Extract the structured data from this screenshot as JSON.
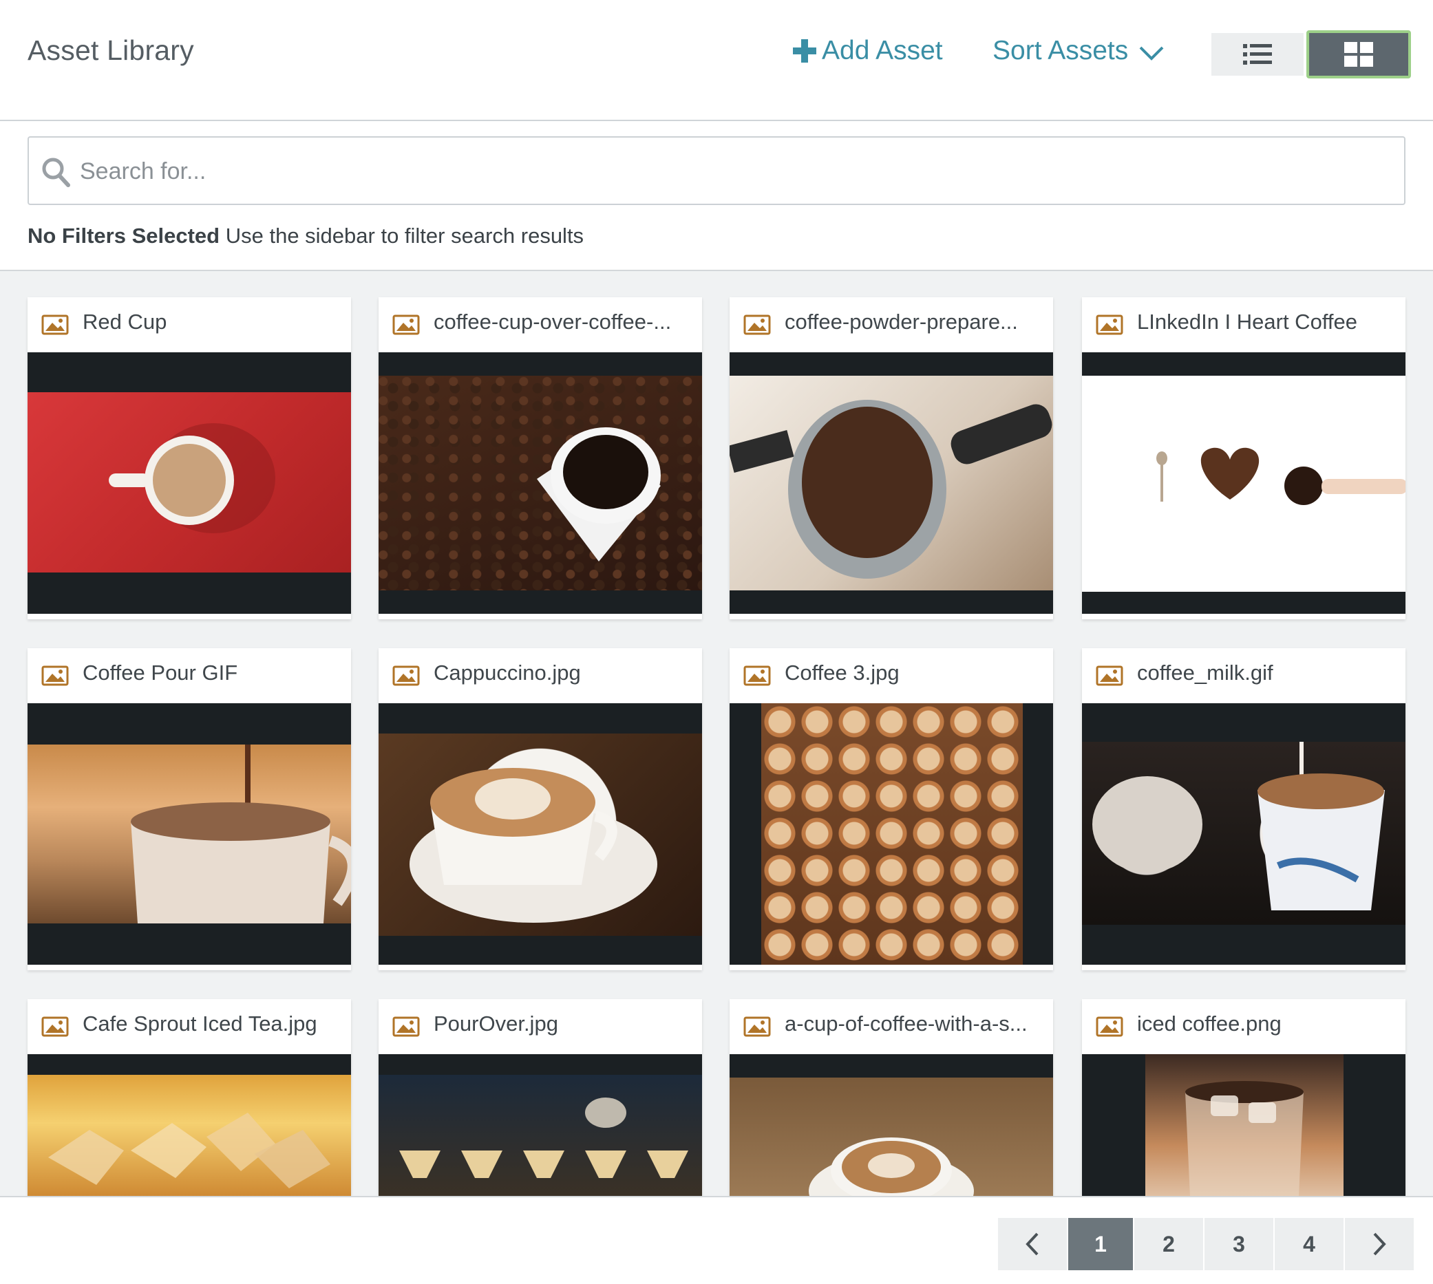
{
  "header": {
    "title": "Asset Library",
    "add_asset_label": "Add Asset",
    "sort_assets_label": "Sort Assets",
    "view_mode": "grid"
  },
  "search": {
    "placeholder": "Search for...",
    "value": ""
  },
  "filters": {
    "status_bold": "No Filters Selected",
    "status_hint": "Use the sidebar to filter search results"
  },
  "assets": [
    {
      "title": "Red Cup",
      "icon": "image-icon",
      "thumb": "red-cup"
    },
    {
      "title": "coffee-cup-over-coffee-...",
      "icon": "image-icon",
      "thumb": "coffee-beans"
    },
    {
      "title": "coffee-powder-prepare...",
      "icon": "image-icon",
      "thumb": "coffee-powder"
    },
    {
      "title": "LInkedIn I Heart Coffee",
      "icon": "image-icon",
      "thumb": "heart-coffee"
    },
    {
      "title": "Coffee Pour GIF",
      "icon": "image-icon",
      "thumb": "coffee-pour"
    },
    {
      "title": "Cappuccino.jpg",
      "icon": "image-icon",
      "thumb": "cappuccino"
    },
    {
      "title": "Coffee 3.jpg",
      "icon": "image-icon",
      "thumb": "latte-heart"
    },
    {
      "title": "coffee_milk.gif",
      "icon": "image-icon",
      "thumb": "coffee-milk"
    },
    {
      "title": "Cafe Sprout Iced Tea.jpg",
      "icon": "image-icon",
      "thumb": "iced-tea"
    },
    {
      "title": "PourOver.jpg",
      "icon": "image-icon",
      "thumb": "pour-over"
    },
    {
      "title": "a-cup-of-coffee-with-a-s...",
      "icon": "image-icon",
      "thumb": "cup-saucer"
    },
    {
      "title": "iced coffee.png",
      "icon": "image-icon",
      "thumb": "iced-coffee"
    }
  ],
  "pagination": {
    "prev_icon": "chevron-left-icon",
    "next_icon": "chevron-right-icon",
    "pages": [
      "1",
      "2",
      "3",
      "4"
    ],
    "current": "1"
  },
  "colors": {
    "accent": "#3a8ea5",
    "grid_toggle_active": "#5d676e",
    "grid_toggle_border": "#9dd089",
    "asset_icon": "#b07428"
  }
}
